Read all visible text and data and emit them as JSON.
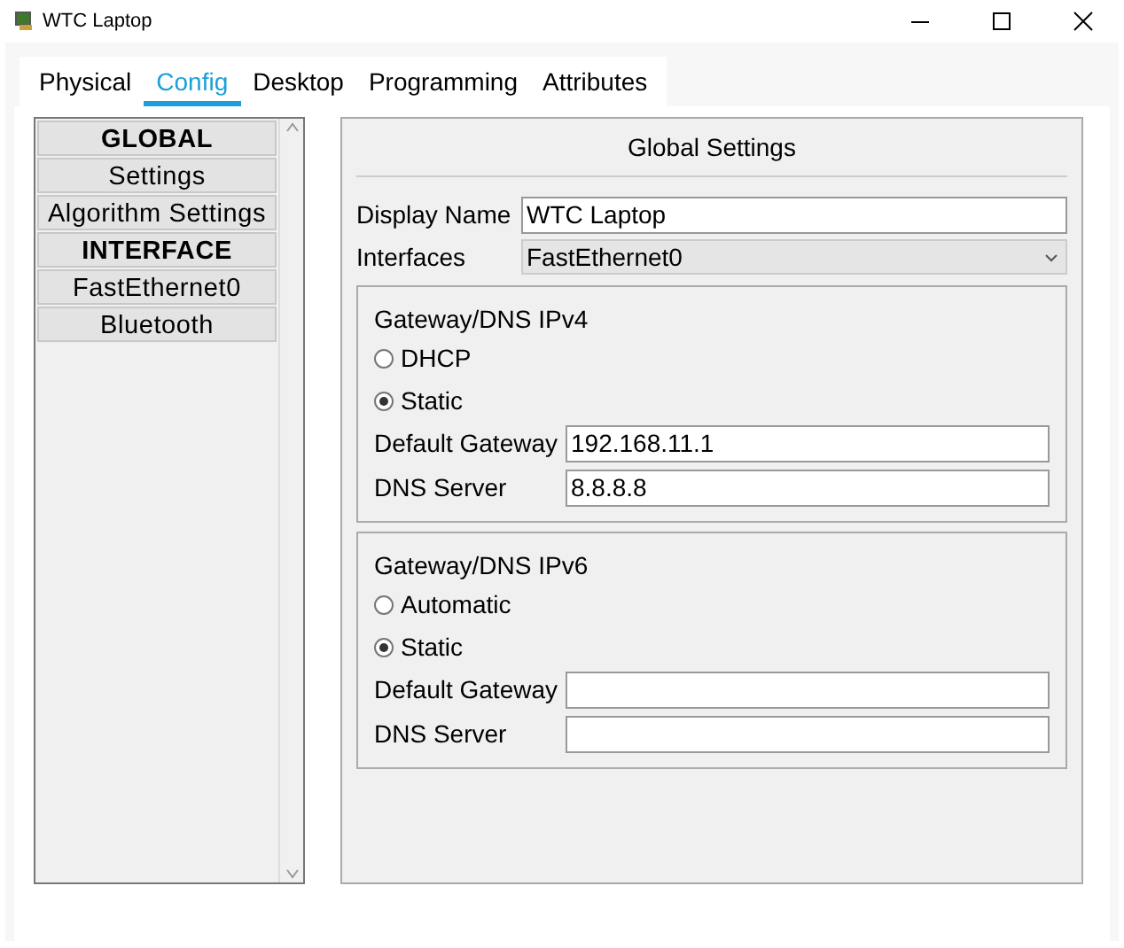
{
  "window": {
    "title": "WTC Laptop"
  },
  "tabs": [
    {
      "label": "Physical",
      "selected": false
    },
    {
      "label": "Config",
      "selected": true
    },
    {
      "label": "Desktop",
      "selected": false
    },
    {
      "label": "Programming",
      "selected": false
    },
    {
      "label": "Attributes",
      "selected": false
    }
  ],
  "sidebar": {
    "items": [
      {
        "kind": "header",
        "label": "GLOBAL"
      },
      {
        "kind": "item",
        "label": "Settings"
      },
      {
        "kind": "item",
        "label": "Algorithm Settings"
      },
      {
        "kind": "header",
        "label": "INTERFACE"
      },
      {
        "kind": "item",
        "label": "FastEthernet0"
      },
      {
        "kind": "item",
        "label": "Bluetooth"
      }
    ]
  },
  "panel": {
    "title": "Global Settings",
    "display_name": {
      "label": "Display Name",
      "value": "WTC Laptop"
    },
    "interfaces": {
      "label": "Interfaces",
      "value": "FastEthernet0"
    },
    "groups": [
      {
        "title": "Gateway/DNS IPv4",
        "options": [
          {
            "label": "DHCP",
            "selected": false
          },
          {
            "label": "Static",
            "selected": true
          }
        ],
        "fields": [
          {
            "label": "Default Gateway",
            "value": "192.168.11.1"
          },
          {
            "label": "DNS Server",
            "value": "8.8.8.8"
          }
        ]
      },
      {
        "title": "Gateway/DNS IPv6",
        "options": [
          {
            "label": "Automatic",
            "selected": false
          },
          {
            "label": "Static",
            "selected": true
          }
        ],
        "fields": [
          {
            "label": "Default Gateway"
          },
          {
            "label": "DNS Server"
          }
        ]
      }
    ]
  }
}
